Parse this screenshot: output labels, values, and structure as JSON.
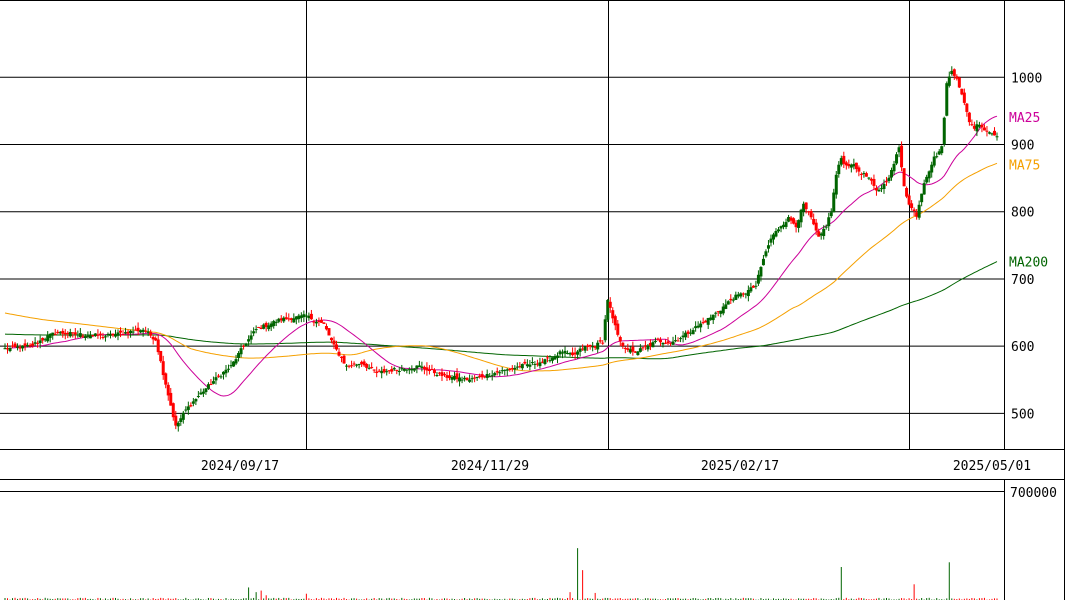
{
  "chart_data": [
    {
      "type": "candlestick",
      "title": "",
      "ylim": [
        447,
        1115
      ],
      "y_ticks": [
        500,
        600,
        700,
        800,
        900,
        1000
      ],
      "y_tick_labels": [
        "500",
        "600",
        "700",
        "800",
        "900",
        "1000"
      ],
      "x_tick_labels": [
        "2024/09/17",
        "2024/11/29",
        "2025/02/17",
        "2025/05/01"
      ],
      "grid": true,
      "series_labels": [
        {
          "name": "MA25",
          "color": "#cc0099"
        },
        {
          "name": "MA75",
          "color": "#f5a000"
        },
        {
          "name": "MA200",
          "color": "#006400"
        }
      ],
      "colors": {
        "up": "#006400",
        "down": "#ff0000",
        "grid": "#000000"
      },
      "anchors": [
        [
          0,
          596
        ],
        [
          10,
          600
        ],
        [
          20,
          620
        ],
        [
          40,
          615
        ],
        [
          55,
          625
        ],
        [
          60,
          610
        ],
        [
          63,
          560
        ],
        [
          68,
          480
        ],
        [
          72,
          505
        ],
        [
          78,
          530
        ],
        [
          85,
          555
        ],
        [
          90,
          570
        ],
        [
          95,
          600
        ],
        [
          100,
          625
        ],
        [
          110,
          640
        ],
        [
          120,
          645
        ],
        [
          127,
          632
        ],
        [
          131,
          600
        ],
        [
          136,
          570
        ],
        [
          142,
          575
        ],
        [
          148,
          560
        ],
        [
          155,
          565
        ],
        [
          165,
          570
        ],
        [
          175,
          555
        ],
        [
          185,
          550
        ],
        [
          195,
          560
        ],
        [
          205,
          570
        ],
        [
          215,
          578
        ],
        [
          222,
          592
        ],
        [
          226,
          585
        ],
        [
          230,
          597
        ],
        [
          235,
          600
        ],
        [
          238,
          608
        ],
        [
          240,
          670
        ],
        [
          242,
          640
        ],
        [
          245,
          605
        ],
        [
          250,
          590
        ],
        [
          255,
          598
        ],
        [
          260,
          608
        ],
        [
          265,
          605
        ],
        [
          270,
          615
        ],
        [
          275,
          628
        ],
        [
          280,
          640
        ],
        [
          285,
          655
        ],
        [
          290,
          672
        ],
        [
          295,
          680
        ],
        [
          299,
          690
        ],
        [
          302,
          730
        ],
        [
          305,
          760
        ],
        [
          309,
          780
        ],
        [
          312,
          790
        ],
        [
          315,
          780
        ],
        [
          318,
          810
        ],
        [
          321,
          790
        ],
        [
          324,
          760
        ],
        [
          327,
          780
        ],
        [
          329,
          800
        ],
        [
          331,
          855
        ],
        [
          333,
          880
        ],
        [
          335,
          868
        ],
        [
          337,
          872
        ],
        [
          340,
          860
        ],
        [
          344,
          850
        ],
        [
          347,
          830
        ],
        [
          350,
          840
        ],
        [
          353,
          860
        ],
        [
          356,
          895
        ],
        [
          358,
          840
        ],
        [
          360,
          810
        ],
        [
          363,
          795
        ],
        [
          366,
          845
        ],
        [
          370,
          880
        ],
        [
          373,
          895
        ],
        [
          375,
          990
        ],
        [
          377,
          1010
        ],
        [
          379,
          1000
        ],
        [
          382,
          960
        ],
        [
          384,
          935
        ],
        [
          386,
          925
        ],
        [
          388,
          932
        ],
        [
          390,
          922
        ],
        [
          393,
          917
        ],
        [
          395,
          915
        ]
      ],
      "last_index": 395,
      "volume": {
        "ylim": [
          0,
          700000
        ],
        "tick_label": "700000",
        "spikes": [
          [
            97,
            80000
          ],
          [
            100,
            50000
          ],
          [
            102,
            60000
          ],
          [
            104,
            30000
          ],
          [
            120,
            40000
          ],
          [
            225,
            50000
          ],
          [
            228,
            330000
          ],
          [
            230,
            190000
          ],
          [
            235,
            45000
          ],
          [
            333,
            210000
          ],
          [
            362,
            100000
          ],
          [
            376,
            240000
          ]
        ]
      }
    }
  ]
}
